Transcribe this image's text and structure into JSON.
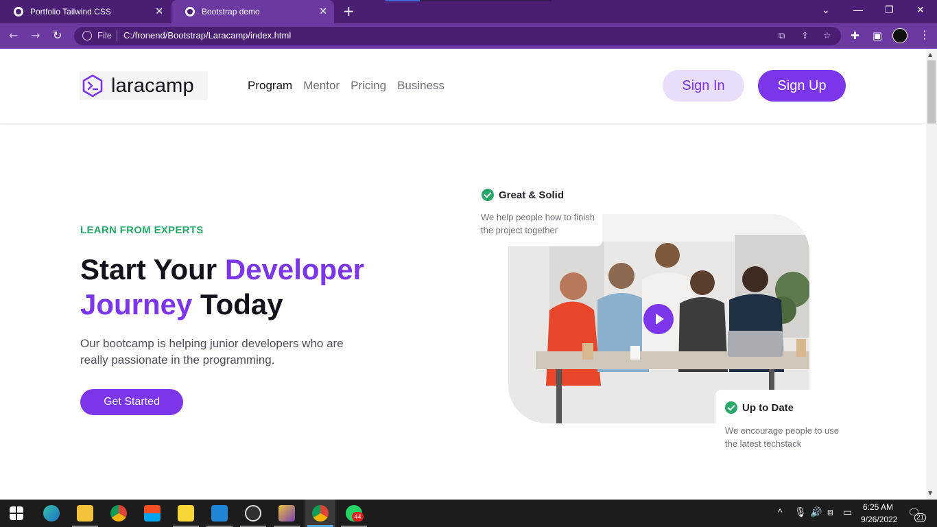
{
  "browser": {
    "tabs": [
      {
        "title": "Portfolio Tailwind CSS",
        "active": false
      },
      {
        "title": "Bootstrap demo",
        "active": true
      }
    ],
    "new_tab": "+",
    "omnibox": {
      "scheme_label": "File",
      "url": "C:/fronend/Bootstrap/Laracamp/index.html"
    },
    "window_controls": [
      "chevron-down-icon",
      "minimize-icon",
      "restore-icon",
      "close-icon"
    ]
  },
  "site": {
    "logo_text": "laracamp",
    "nav": [
      {
        "label": "Program",
        "active": true
      },
      {
        "label": "Mentor",
        "active": false
      },
      {
        "label": "Pricing",
        "active": false
      },
      {
        "label": "Business",
        "active": false
      }
    ],
    "signin_label": "Sign In",
    "signup_label": "Sign Up",
    "colors": {
      "primary": "#7b35ea",
      "primary_soft": "#e9ddfc",
      "green": "#27a86a",
      "ink": "#13111a"
    }
  },
  "hero": {
    "eyebrow": "LEARN FROM EXPERTS",
    "headline_part1": "Start Your ",
    "headline_accent1": "Developer",
    "headline_accent2": "Journey",
    "headline_part2": " Today",
    "lead": "Our bootcamp is helping junior developers who are really passionate in the programming.",
    "cta_label": "Get Started",
    "card1": {
      "title": "Great & Solid",
      "desc": "We help people how to finish the project together"
    },
    "card2": {
      "title": "Up to Date",
      "desc": "We encourage people to use the latest techstack"
    }
  },
  "taskbar": {
    "apps": [
      "windows-start-icon",
      "edge-icon",
      "file-explorer-icon",
      "chrome-icon",
      "store-icon",
      "sticky-notes-icon",
      "vscode-icon",
      "obs-icon",
      "git-icon",
      "chrome-profile-icon",
      "whatsapp-icon"
    ],
    "whatsapp_badge": "44",
    "time": "6:25 AM",
    "date": "9/26/2022",
    "notification_count": "21"
  }
}
